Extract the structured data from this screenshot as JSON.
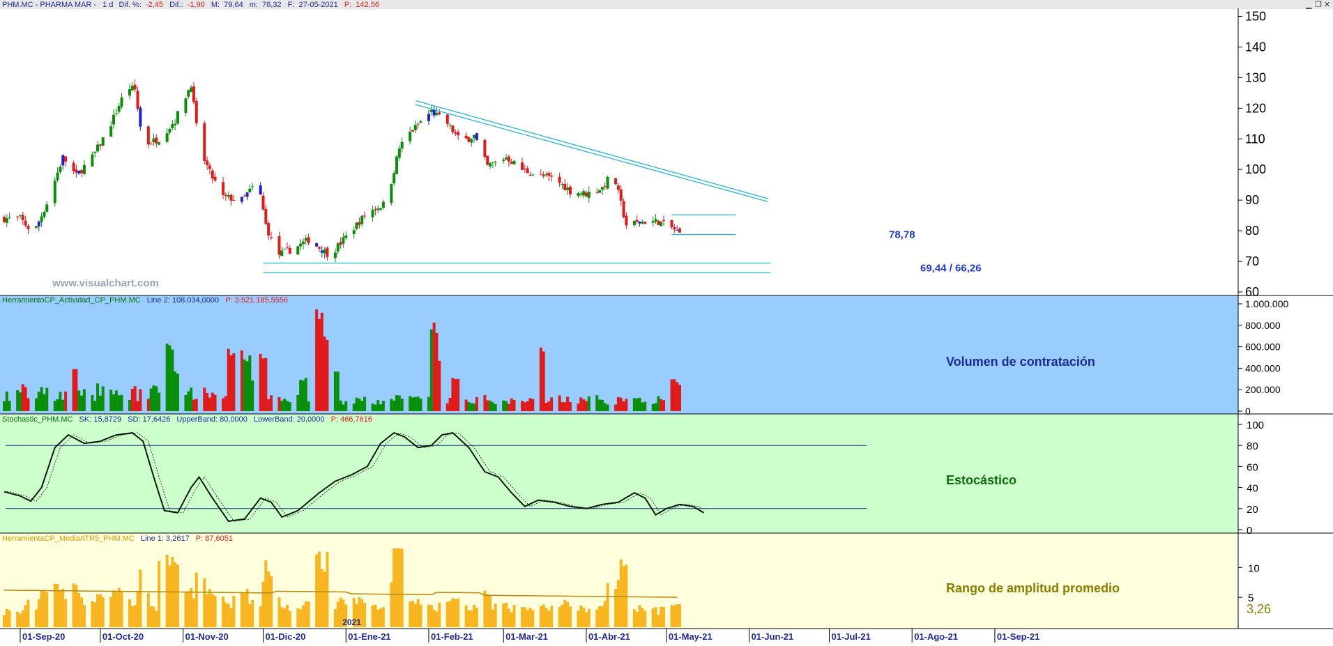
{
  "colors": {
    "panel1_bg": "#ffffff",
    "panel2_bg": "#99ccff",
    "panel3_bg": "#ccffcc",
    "panel4_bg": "#ffffdd",
    "bull": "#0a8f0a",
    "bear": "#e01b1b",
    "blue_candle": "#1f1fd0",
    "trendline": "#1fb8d6",
    "osc_line": "#1a2a8a",
    "atr_bar": "#f7b520",
    "atr_avg": "#b8860b",
    "title_blue": "#1d2a9a",
    "label_blue": "#1f3ad6",
    "label_green": "#0b6e0b",
    "label_olive": "#8a7d00"
  },
  "header": {
    "symbol": "PHM.MC - PHARMA MAR -",
    "period": "1 d",
    "dif_pct_label": "Dif. %:",
    "dif_pct": "-2,45",
    "dif_label": "Dif.:",
    "dif": "-1,90",
    "m_label": "M:",
    "m": "79,64",
    "m2_label": "m:",
    "m2": "76,32",
    "f_label": "F:",
    "f": "27-05-2021",
    "p_label": "P:",
    "p": "142,56"
  },
  "watermark": "www.visualchart.com",
  "panels": {
    "volume": {
      "header_name": "HerramientoCP_Actividad_CP_PHM.MC",
      "header_line": "Line 2: 108.034,0000",
      "header_p": "P: 3.521.185,5556",
      "label": "Volumen de contratación",
      "ticks": [
        "1.000.000",
        "800.000",
        "600.000",
        "400.000",
        "200.000",
        "0"
      ]
    },
    "stochastic": {
      "header_name": "Stochastic_PHM.MC",
      "header_sk": "SK: 15,8729",
      "header_sd": "SD: 17,6426",
      "header_ub": "UpperBand: 80,0000",
      "header_lb": "LowerBand: 20,0000",
      "header_p": "P: 466,7616",
      "label": "Estocástico",
      "ticks": [
        "100",
        "80",
        "60",
        "40",
        "20",
        "0"
      ]
    },
    "atr": {
      "header_name": "HerramientaCP_MediaATR5_PHM.MC",
      "header_line": "Line 1: 3,2617",
      "header_p": "P: 87,6051",
      "label": "Rango de amplitud promedio",
      "ticks": [
        "10",
        "5"
      ],
      "last_value": "3,26"
    }
  },
  "chart_data": {
    "type": "candlestick",
    "title": "",
    "price_ticks": [
      150,
      140,
      130,
      120,
      110,
      100,
      90,
      80,
      70,
      60
    ],
    "ylim": [
      60,
      152
    ],
    "annotations": {
      "support_label": "78,78",
      "support_value": 78.78,
      "lower_label": "69,44 / 66,26",
      "lower_values": [
        69.44,
        66.26
      ],
      "resistance_top": 85.2
    },
    "trendline": {
      "start": {
        "date": "2021-01-27",
        "value": 122.5
      },
      "end": {
        "date": "2021-06-08",
        "value": 90.5
      },
      "start_lower": {
        "date": "2021-01-27",
        "value": 121.2
      },
      "end_lower": {
        "date": "2021-06-08",
        "value": 89.5
      }
    },
    "x_axis_labels": [
      "01-Sep-20",
      "01-Oct-20",
      "01-Nov-20",
      "01-Dic-20",
      "01-Ene-21",
      "01-Feb-21",
      "01-Mar-21",
      "01-Abr-21",
      "01-May-21",
      "01-Jun-21",
      "01-Jul-21",
      "01-Ago-21",
      "01-Sep-21"
    ],
    "year_label": "2021",
    "anchors": [
      {
        "d": 0,
        "c": 84
      },
      {
        "d": 6,
        "c": 84
      },
      {
        "d": 11,
        "c": 79
      },
      {
        "d": 16,
        "c": 89
      },
      {
        "d": 22,
        "c": 104
      },
      {
        "d": 27,
        "c": 98
      },
      {
        "d": 33,
        "c": 104
      },
      {
        "d": 39,
        "c": 113
      },
      {
        "d": 46,
        "c": 127
      },
      {
        "d": 49,
        "c": 126
      },
      {
        "d": 52,
        "c": 108
      },
      {
        "d": 58,
        "c": 110
      },
      {
        "d": 64,
        "c": 116
      },
      {
        "d": 70,
        "c": 128
      },
      {
        "d": 73,
        "c": 107
      },
      {
        "d": 77,
        "c": 99
      },
      {
        "d": 82,
        "c": 91
      },
      {
        "d": 89,
        "c": 90
      },
      {
        "d": 95,
        "c": 96
      },
      {
        "d": 98,
        "c": 82
      },
      {
        "d": 102,
        "c": 72
      },
      {
        "d": 108,
        "c": 74
      },
      {
        "d": 114,
        "c": 77
      },
      {
        "d": 122,
        "c": 72
      },
      {
        "d": 128,
        "c": 78
      },
      {
        "d": 136,
        "c": 86
      },
      {
        "d": 143,
        "c": 89
      },
      {
        "d": 148,
        "c": 107
      },
      {
        "d": 152,
        "c": 112
      },
      {
        "d": 160,
        "c": 119
      },
      {
        "d": 166,
        "c": 115
      },
      {
        "d": 171,
        "c": 109
      },
      {
        "d": 176,
        "c": 111
      },
      {
        "d": 181,
        "c": 101
      },
      {
        "d": 188,
        "c": 104
      },
      {
        "d": 194,
        "c": 100
      },
      {
        "d": 200,
        "c": 98
      },
      {
        "d": 206,
        "c": 97
      },
      {
        "d": 212,
        "c": 93
      },
      {
        "d": 218,
        "c": 92
      },
      {
        "d": 224,
        "c": 94
      },
      {
        "d": 228,
        "c": 99
      },
      {
        "d": 233,
        "c": 82
      },
      {
        "d": 240,
        "c": 83
      },
      {
        "d": 245,
        "c": 83
      },
      {
        "d": 250,
        "c": 81
      },
      {
        "d": 253,
        "c": 79
      }
    ],
    "stochastic_anchors": [
      {
        "d": 0,
        "v": 36
      },
      {
        "d": 6,
        "v": 32
      },
      {
        "d": 10,
        "v": 27
      },
      {
        "d": 14,
        "v": 40
      },
      {
        "d": 19,
        "v": 78
      },
      {
        "d": 24,
        "v": 90
      },
      {
        "d": 30,
        "v": 82
      },
      {
        "d": 36,
        "v": 84
      },
      {
        "d": 42,
        "v": 90
      },
      {
        "d": 48,
        "v": 92
      },
      {
        "d": 52,
        "v": 84
      },
      {
        "d": 56,
        "v": 50
      },
      {
        "d": 60,
        "v": 18
      },
      {
        "d": 65,
        "v": 16
      },
      {
        "d": 70,
        "v": 40
      },
      {
        "d": 73,
        "v": 50
      },
      {
        "d": 78,
        "v": 30
      },
      {
        "d": 84,
        "v": 8
      },
      {
        "d": 90,
        "v": 10
      },
      {
        "d": 96,
        "v": 30
      },
      {
        "d": 100,
        "v": 26
      },
      {
        "d": 104,
        "v": 12
      },
      {
        "d": 110,
        "v": 18
      },
      {
        "d": 118,
        "v": 35
      },
      {
        "d": 124,
        "v": 46
      },
      {
        "d": 130,
        "v": 52
      },
      {
        "d": 136,
        "v": 60
      },
      {
        "d": 141,
        "v": 82
      },
      {
        "d": 146,
        "v": 92
      },
      {
        "d": 150,
        "v": 88
      },
      {
        "d": 155,
        "v": 78
      },
      {
        "d": 160,
        "v": 80
      },
      {
        "d": 164,
        "v": 90
      },
      {
        "d": 168,
        "v": 92
      },
      {
        "d": 174,
        "v": 78
      },
      {
        "d": 180,
        "v": 55
      },
      {
        "d": 185,
        "v": 50
      },
      {
        "d": 190,
        "v": 35
      },
      {
        "d": 195,
        "v": 22
      },
      {
        "d": 200,
        "v": 28
      },
      {
        "d": 206,
        "v": 26
      },
      {
        "d": 212,
        "v": 22
      },
      {
        "d": 218,
        "v": 20
      },
      {
        "d": 224,
        "v": 24
      },
      {
        "d": 230,
        "v": 26
      },
      {
        "d": 236,
        "v": 35
      },
      {
        "d": 240,
        "v": 30
      },
      {
        "d": 244,
        "v": 14
      },
      {
        "d": 248,
        "v": 20
      },
      {
        "d": 253,
        "v": 24
      },
      {
        "d": 258,
        "v": 22
      },
      {
        "d": 262,
        "v": 16
      }
    ],
    "volume_peaks": [
      {
        "d": 118,
        "v": 960000
      },
      {
        "d": 121,
        "v": 700000
      },
      {
        "d": 124,
        "v": 380000
      },
      {
        "d": 161,
        "v": 840000
      },
      {
        "d": 163,
        "v": 480000
      },
      {
        "d": 169,
        "v": 330000
      },
      {
        "d": 201,
        "v": 600000
      },
      {
        "d": 250,
        "v": 300000
      },
      {
        "d": 253,
        "v": 280000
      },
      {
        "d": 112,
        "v": 330000
      },
      {
        "d": 60,
        "v": 660000
      },
      {
        "d": 62,
        "v": 670000
      },
      {
        "d": 64,
        "v": 380000
      },
      {
        "d": 85,
        "v": 580000
      },
      {
        "d": 88,
        "v": 630000
      },
      {
        "d": 91,
        "v": 520000
      },
      {
        "d": 94,
        "v": 300000
      },
      {
        "d": 97,
        "v": 540000
      },
      {
        "d": 26,
        "v": 430000
      },
      {
        "d": 17,
        "v": 250000
      }
    ],
    "atr_ylim": [
      0,
      14
    ],
    "atr_last": 3.26
  }
}
